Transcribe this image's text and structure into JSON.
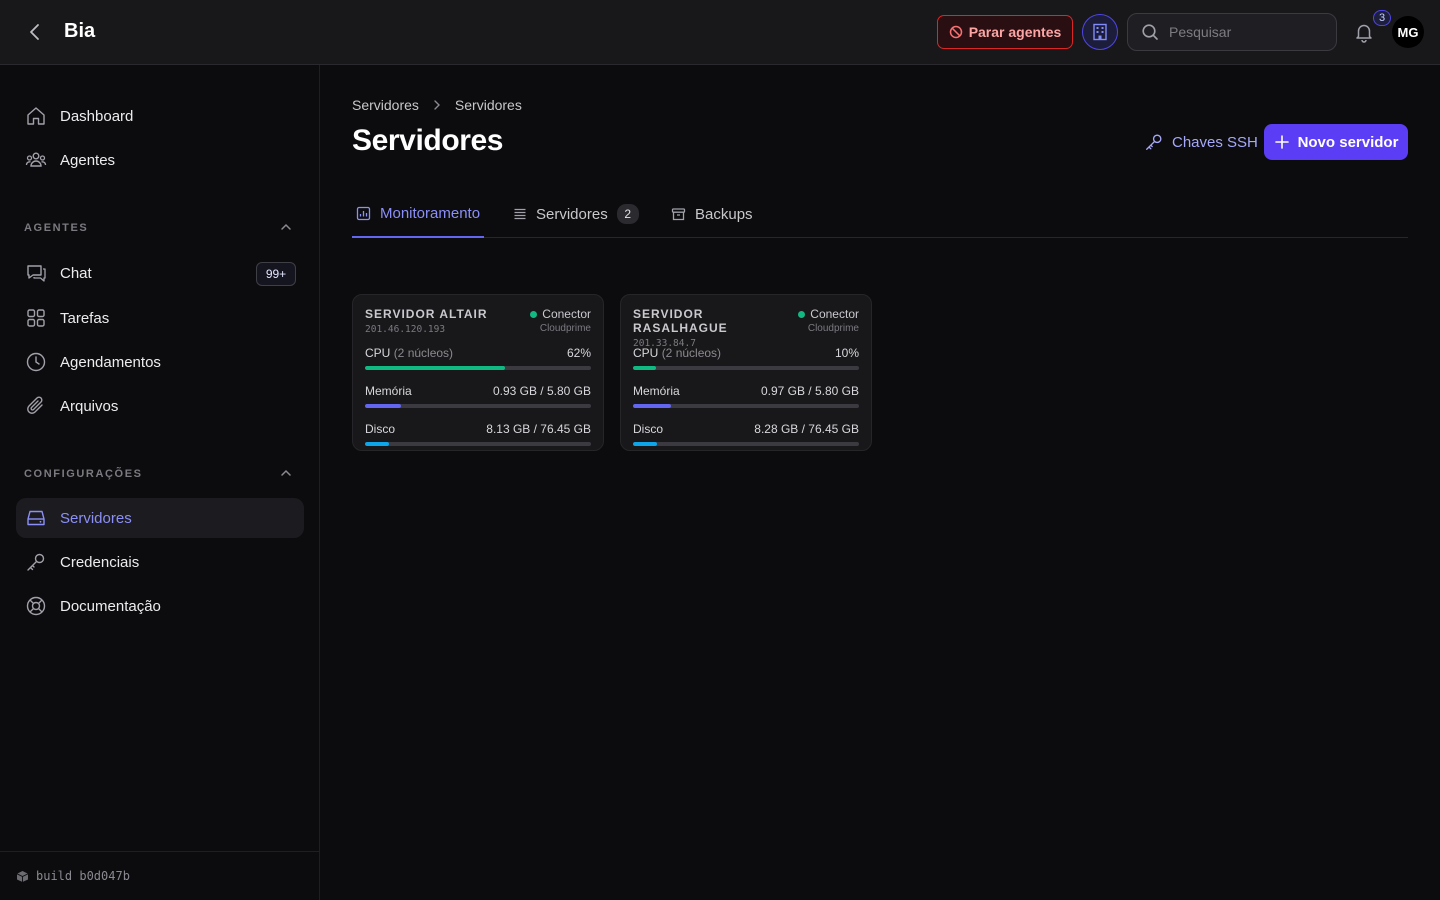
{
  "topbar": {
    "app_title": "Bia",
    "stop_agents_label": "Parar agentes",
    "search_placeholder": "Pesquisar",
    "notifications_count": "3",
    "avatar_initials": "MG"
  },
  "sidebar": {
    "top_items": [
      {
        "label": "Dashboard",
        "icon": "home-icon"
      },
      {
        "label": "Agentes",
        "icon": "users-icon"
      }
    ],
    "agents_section": {
      "title": "AGENTES",
      "items": [
        {
          "label": "Chat",
          "icon": "chat-icon",
          "badge": "99+"
        },
        {
          "label": "Tarefas",
          "icon": "grid-icon"
        },
        {
          "label": "Agendamentos",
          "icon": "clock-icon"
        },
        {
          "label": "Arquivos",
          "icon": "paperclip-icon"
        }
      ]
    },
    "config_section": {
      "title": "CONFIGURAÇÕES",
      "items": [
        {
          "label": "Servidores",
          "icon": "server-icon",
          "active": true
        },
        {
          "label": "Credenciais",
          "icon": "key-icon"
        },
        {
          "label": "Documentação",
          "icon": "lifebuoy-icon"
        }
      ]
    },
    "build_label": "build b0d047b"
  },
  "main": {
    "breadcrumb": [
      "Servidores",
      "Servidores"
    ],
    "title": "Servidores",
    "ssh_keys_label": "Chaves SSH",
    "new_server_label": "Novo servidor",
    "tabs": [
      {
        "label": "Monitoramento",
        "icon": "chart-icon",
        "active": true
      },
      {
        "label": "Servidores",
        "icon": "list-icon",
        "count": "2"
      },
      {
        "label": "Backups",
        "icon": "archive-icon"
      }
    ],
    "servers": [
      {
        "name": "SERVIDOR ALTAIR",
        "ip": "201.46.120.193",
        "connector_label": "Conector",
        "provider": "Cloudprime",
        "cpu_label": "CPU",
        "cpu_cores": "(2 núcleos)",
        "cpu_value": "62%",
        "cpu_fraction": 0.62,
        "memory_label": "Memória",
        "memory_value": "0.93 GB / 5.80 GB",
        "memory_fraction": 0.16,
        "disk_label": "Disco",
        "disk_value": "8.13 GB / 76.45 GB",
        "disk_fraction": 0.106
      },
      {
        "name": "SERVIDOR RASALHAGUE",
        "ip": "201.33.84.7",
        "connector_label": "Conector",
        "provider": "Cloudprime",
        "cpu_label": "CPU",
        "cpu_cores": "(2 núcleos)",
        "cpu_value": "10%",
        "cpu_fraction": 0.1,
        "memory_label": "Memória",
        "memory_value": "0.97 GB / 5.80 GB",
        "memory_fraction": 0.167,
        "disk_label": "Disco",
        "disk_value": "8.28 GB / 76.45 GB",
        "disk_fraction": 0.108
      }
    ]
  },
  "colors": {
    "accent": "#5b3df5",
    "active_text": "#8b8ff7",
    "cpu_bar": "#10b981",
    "memory_bar": "#6366f1",
    "disk_bar": "#0ea5e9",
    "status_online": "#10b981",
    "danger": "#dc2626"
  }
}
